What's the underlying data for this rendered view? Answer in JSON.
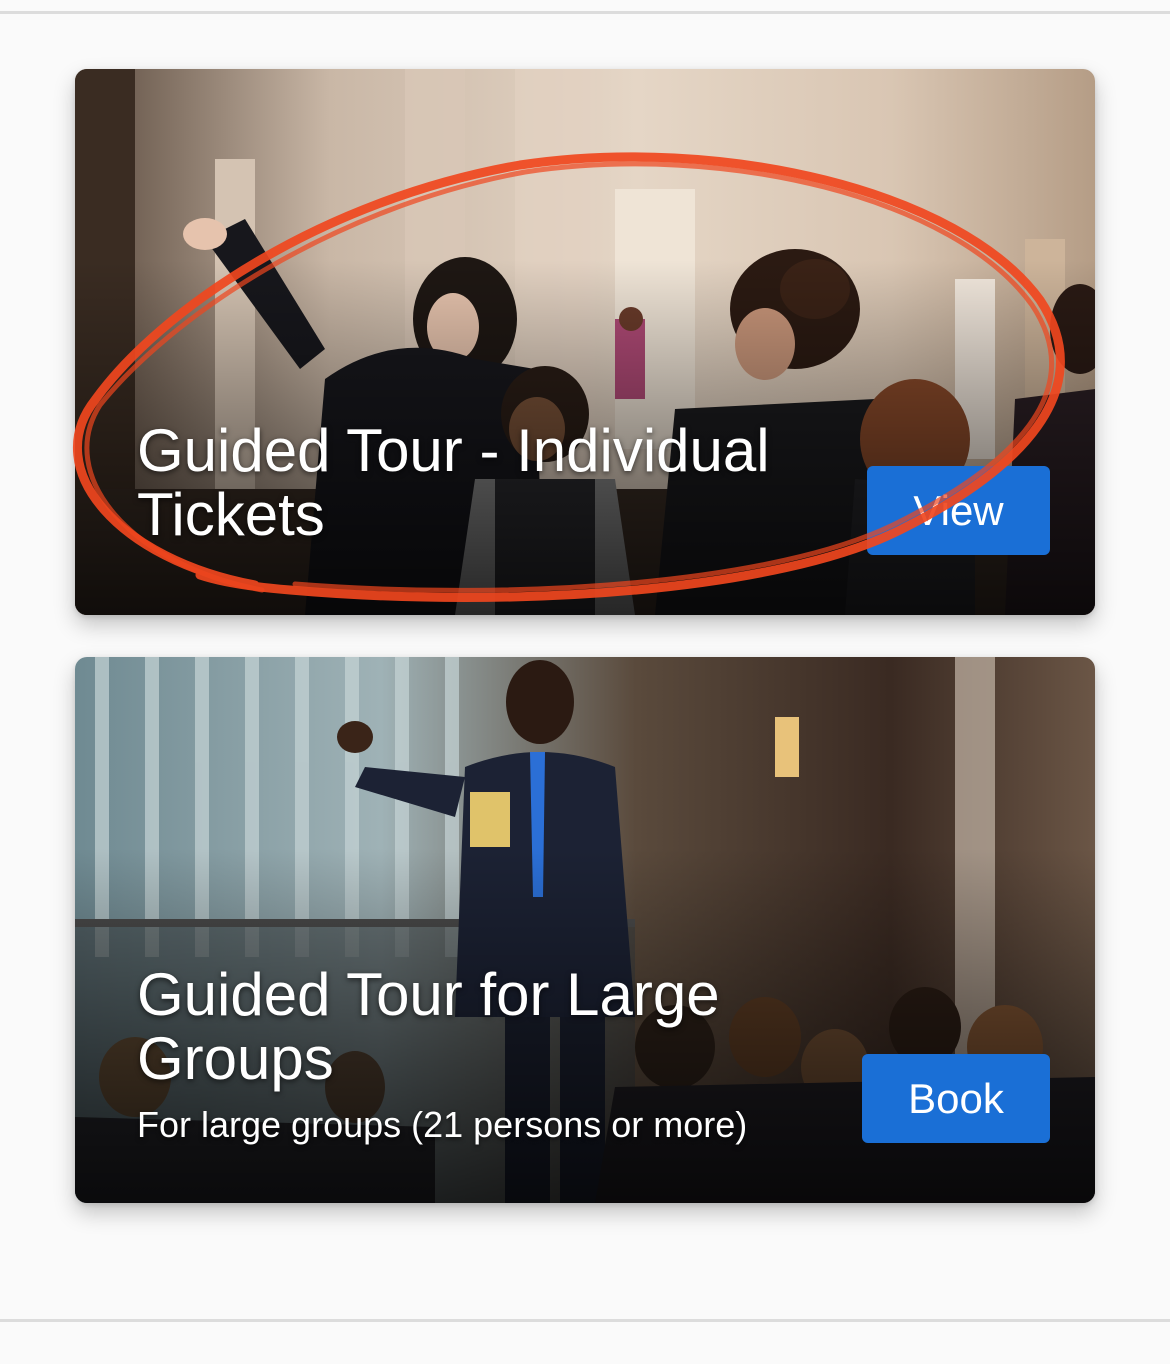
{
  "cards": [
    {
      "title": "Guided Tour - Individual Tickets",
      "subtitle": "",
      "button_label": "View",
      "photo": "tour-guide-gallery-photo"
    },
    {
      "title": "Guided Tour for Large Groups",
      "subtitle": "For large groups (21 persons or more)",
      "button_label": "Book",
      "photo": "tour-guide-students-photo"
    }
  ],
  "colors": {
    "background": "#fafafa",
    "button": "#1a6fd6",
    "annotation": "#f0461e"
  }
}
